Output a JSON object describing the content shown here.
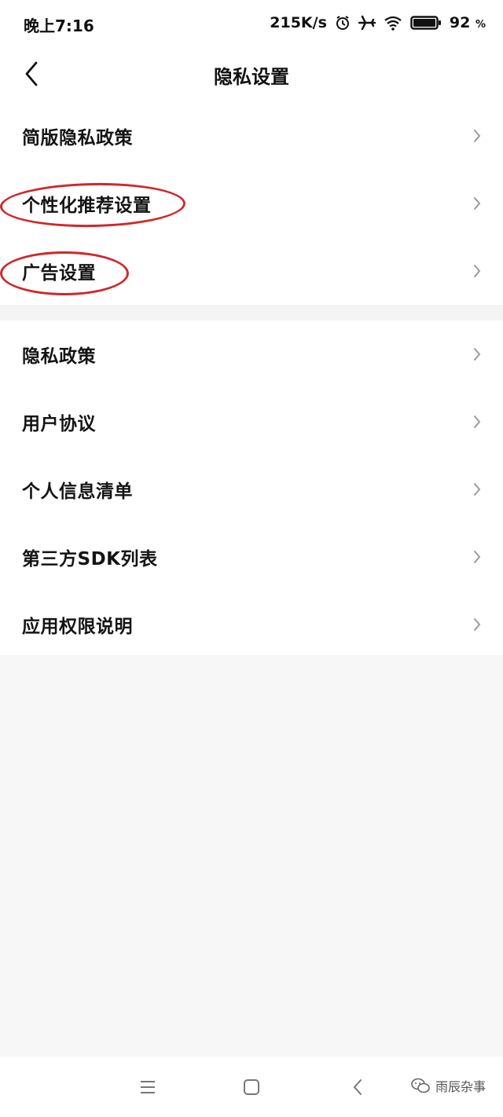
{
  "status": {
    "time": "晚上7:16",
    "net_speed": "215K/s",
    "battery_percent": "92",
    "battery_unit": "%",
    "icons": [
      "alarm-icon",
      "airplane-icon",
      "wifi-icon",
      "battery-icon"
    ]
  },
  "header": {
    "title": "隐私设置"
  },
  "group1": {
    "items": [
      {
        "label": "简版隐私政策"
      },
      {
        "label": "个性化推荐设置"
      },
      {
        "label": "广告设置"
      }
    ]
  },
  "group2": {
    "items": [
      {
        "label": "隐私政策"
      },
      {
        "label": "用户协议"
      },
      {
        "label": "个人信息清单"
      },
      {
        "label": "第三方SDK列表"
      },
      {
        "label": "应用权限说明"
      }
    ]
  },
  "annotation": {
    "color": "#d1262b"
  },
  "watermark": {
    "text": "雨辰杂事"
  },
  "colors": {
    "background": "#f7f7f7",
    "surface": "#ffffff",
    "text": "#141414",
    "chevron": "#9a9a9a"
  }
}
